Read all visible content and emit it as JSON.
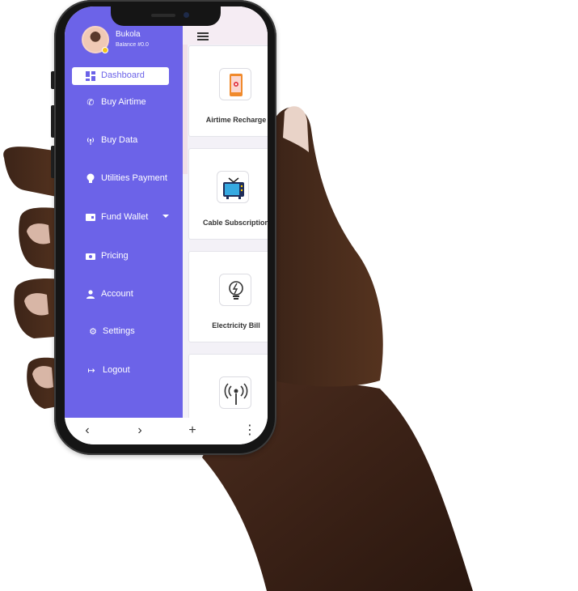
{
  "user": {
    "name": "Bukola",
    "balance": "Balance #0.0"
  },
  "menu": {
    "items": [
      {
        "label": "Dashboard",
        "icon": "dashboard-icon"
      },
      {
        "label": "Buy Airtime",
        "icon": "phone-icon"
      },
      {
        "label": "Buy Data",
        "icon": "signal-icon"
      },
      {
        "label": "Utilities Payment",
        "icon": "bulb-icon"
      },
      {
        "label": "Fund Wallet",
        "icon": "wallet-icon"
      },
      {
        "label": "Pricing",
        "icon": "money-icon"
      },
      {
        "label": "Account",
        "icon": "user-icon"
      },
      {
        "label": "Settings",
        "icon": "gear-icon"
      },
      {
        "label": "Logout",
        "icon": "logout-icon"
      }
    ]
  },
  "services": [
    {
      "label": "Airtime Recharge",
      "icon": "smartphone-icon"
    },
    {
      "label": "Cable Subscription",
      "icon": "tv-icon"
    },
    {
      "label": "Electricity Bill",
      "icon": "lightbulb-icon"
    },
    {
      "label": "",
      "icon": "antenna-icon"
    }
  ],
  "colors": {
    "accent": "#6c63e8",
    "topbar": "#f5ecf3",
    "card_border": "#e4e4ea"
  },
  "bottom_nav": {
    "back_icon": "chevron-left-icon",
    "forward_icon": "chevron-right-icon",
    "add_icon": "plus-icon",
    "more_icon": "more-vertical-icon"
  }
}
